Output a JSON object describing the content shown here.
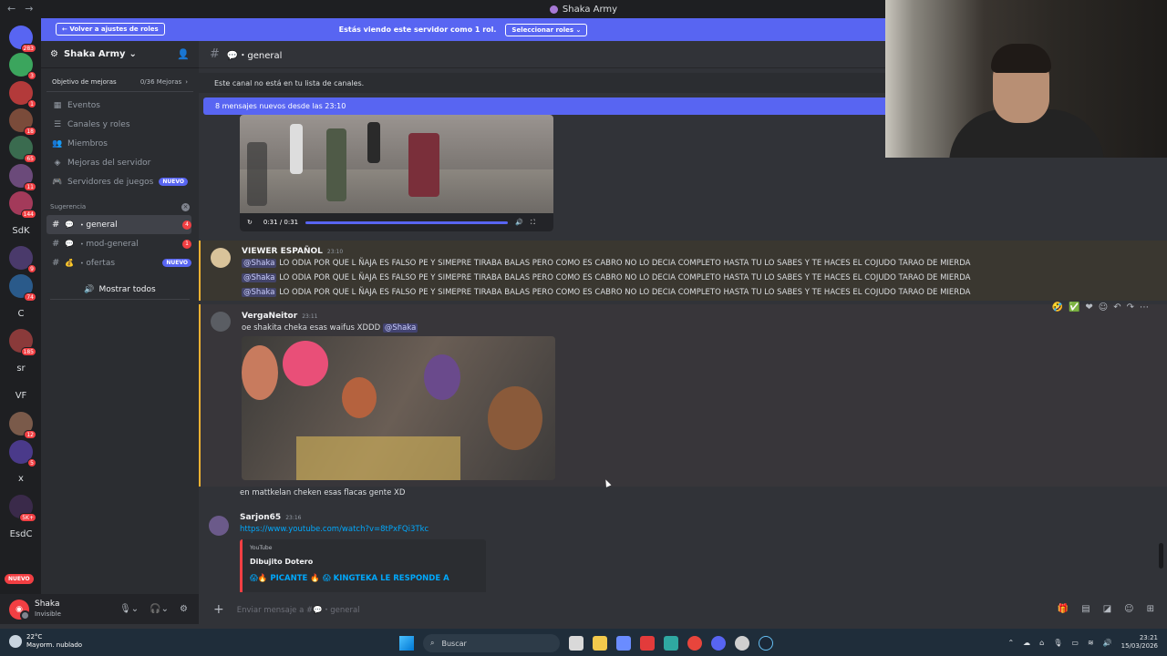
{
  "window": {
    "title": "Shaka Army"
  },
  "banner": {
    "back_label": "Volver a ajustes de roles",
    "text": "Estás viendo este servidor como 1 rol.",
    "select_label": "Seleccionar roles"
  },
  "guilds": [
    {
      "badge": "283"
    },
    {
      "badge": "3"
    },
    {
      "badge": "1"
    },
    {
      "badge": "18"
    },
    {
      "badge": "65"
    },
    {
      "badge": "11"
    },
    {
      "badge": "144"
    },
    {
      "label": "SdK"
    },
    {
      "badge": "9"
    },
    {
      "badge": "74"
    },
    {
      "label": "C"
    },
    {
      "badge": "185"
    },
    {
      "label": "sr"
    },
    {
      "label": "VF"
    },
    {
      "badge": "12"
    },
    {
      "badge": "5"
    },
    {
      "label": "x"
    },
    {
      "badge": "5K+"
    },
    {
      "label": "EsdC"
    }
  ],
  "guilds_new": "NUEVO",
  "server": {
    "name": "Shaka Army",
    "boost_label": "Objetivo de mejoras",
    "boost_count": "0/36 Mejoras",
    "menu": [
      {
        "label": "Eventos",
        "icon": "calendar-icon"
      },
      {
        "label": "Canales y roles",
        "icon": "list-icon"
      },
      {
        "label": "Miembros",
        "icon": "members-icon"
      },
      {
        "label": "Mejoras del servidor",
        "icon": "boost-icon"
      },
      {
        "label": "Servidores de juegos",
        "icon": "gamepad-icon",
        "tag": "NUEVO"
      }
    ],
    "category": "Sugerencia",
    "channels": [
      {
        "name": "general",
        "emoji": "💬",
        "count": "4",
        "active": true
      },
      {
        "name": "mod-general",
        "emoji": "💬",
        "count": "1"
      },
      {
        "name": "ofertas",
        "emoji": "💰",
        "tag": "NUEVO"
      }
    ],
    "show_all": "Mostrar todos"
  },
  "user": {
    "name": "Shaka",
    "status": "Invisible"
  },
  "channel_header": {
    "name": "💬・general"
  },
  "notice": "Este canal no está en tu lista de canales.",
  "new_messages": "8 mensajes nuevos desde las 23:10",
  "video": {
    "time": "0:31 / 0:31"
  },
  "messages": [
    {
      "author": "VIEWER ESPAÑOL",
      "time": "23:10",
      "mention": "@Shaka",
      "lines": [
        "LO ODIA POR QUE L ÑAJA ES FALSO PE Y SIMEPRE TIRABA BALAS PERO COMO ES CABRO NO LO DECIA COMPLETO HASTA TU LO SABES Y TE HACES EL COJUDO TARAO DE MIERDA",
        "LO ODIA POR QUE L ÑAJA ES FALSO PE Y SIMEPRE TIRABA BALAS PERO COMO ES CABRO NO LO DECIA COMPLETO HASTA TU LO SABES Y TE HACES EL COJUDO TARAO DE MIERDA",
        "LO ODIA POR QUE L ÑAJA ES FALSO PE Y SIMEPRE TIRABA BALAS PERO COMO ES CABRO NO LO DECIA COMPLETO HASTA TU LO SABES Y TE HACES EL COJUDO TARAO DE MIERDA"
      ]
    },
    {
      "author": "VergaNeitor",
      "time": "23:11",
      "text": "oe shakita cheka esas waifus XDDD",
      "mention": "@Shaka",
      "followup": "en mattkelan cheken esas flacas gente XD"
    },
    {
      "author": "Sarjon65",
      "time": "23:16",
      "link": "https://www.youtube.com/watch?v=8tPxFQi3Tkc",
      "embed_provider": "YouTube",
      "embed_author": "Dibujito Dotero",
      "embed_title": "😱🔥 PICANTE 🔥 😱 KINGTEKA LE RESPONDE A"
    }
  ],
  "composer": {
    "placeholder": "Enviar mensaje a #💬・general"
  },
  "taskbar": {
    "temp": "22°C",
    "weather": "Mayorm. nublado",
    "search": "Buscar",
    "time": "23:21",
    "date": "15/03/2026"
  }
}
